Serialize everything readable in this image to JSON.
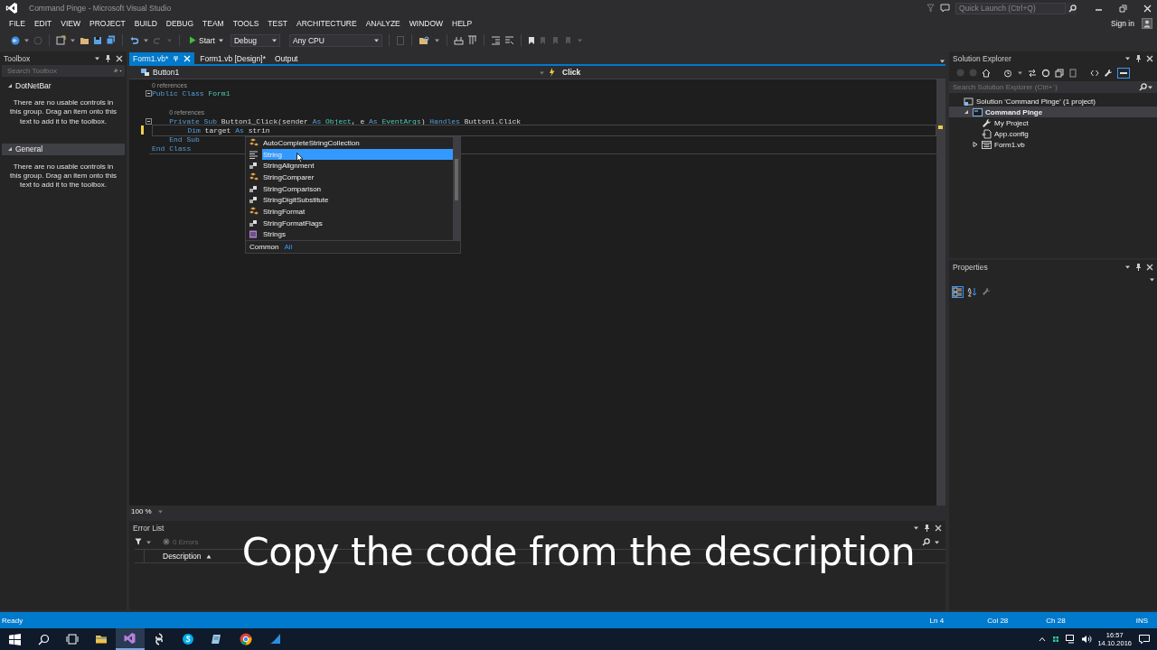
{
  "window": {
    "title": "Command Pinge - Microsoft Visual Studio"
  },
  "quick_launch": {
    "placeholder": "Quick Launch (Ctrl+Q)"
  },
  "account": "Sign in",
  "menu": [
    "FILE",
    "EDIT",
    "VIEW",
    "PROJECT",
    "BUILD",
    "DEBUG",
    "TEAM",
    "TOOLS",
    "TEST",
    "ARCHITECTURE",
    "ANALYZE",
    "WINDOW",
    "HELP"
  ],
  "toolbar": {
    "start": "Start",
    "configuration": "Debug",
    "platform": "Any CPU"
  },
  "toolbox": {
    "title": "Toolbox",
    "search_placeholder": "Search Toolbox",
    "groups": [
      {
        "name": "DotNetBar",
        "expanded": true,
        "selected": false,
        "message": "There are no usable controls in this group. Drag an item onto this text to add it to the toolbox."
      },
      {
        "name": "General",
        "expanded": true,
        "selected": true,
        "message": "There are no usable controls in this group. Drag an item onto this text to add it to the toolbox."
      }
    ]
  },
  "editor": {
    "tabs": [
      {
        "label": "Form1.vb*",
        "selected": true
      },
      {
        "label": "Form1.vb [Design]*",
        "selected": false
      },
      {
        "label": "Output",
        "selected": false
      }
    ],
    "member_bar": {
      "object": "Button1",
      "event": "Click"
    },
    "lines": [
      {
        "kind": "code",
        "lens": "0 references",
        "fold": true,
        "current": false,
        "modified": false,
        "tokens": [
          {
            "kind": "keyword",
            "t": "Public Class "
          },
          {
            "kind": "type",
            "t": "Form1"
          }
        ]
      },
      {
        "kind": "blank"
      },
      {
        "kind": "code",
        "lens": "0 references",
        "fold": true,
        "current": false,
        "modified": false,
        "tokens": [
          {
            "kind": "keyword",
            "t": "    Private Sub "
          },
          {
            "kind": "plain",
            "t": "Button1_Click(sender "
          },
          {
            "kind": "keyword",
            "t": "As "
          },
          {
            "kind": "type",
            "t": "Object"
          },
          {
            "kind": "plain",
            "t": ", e "
          },
          {
            "kind": "keyword",
            "t": "As "
          },
          {
            "kind": "type",
            "t": "EventArgs"
          },
          {
            "kind": "plain",
            "t": ") "
          },
          {
            "kind": "keyword",
            "t": "Handles "
          },
          {
            "kind": "plain",
            "t": "Button1.Click"
          }
        ]
      },
      {
        "kind": "code",
        "fold": false,
        "current": true,
        "modified": true,
        "tokens": [
          {
            "kind": "keyword",
            "t": "        Dim "
          },
          {
            "kind": "plain",
            "t": "target "
          },
          {
            "kind": "keyword",
            "t": "As "
          },
          {
            "kind": "plain",
            "t": "strin"
          }
        ]
      },
      {
        "kind": "code",
        "fold": false,
        "current": false,
        "modified": false,
        "tokens": [
          {
            "kind": "keyword",
            "t": "    End Sub"
          }
        ]
      },
      {
        "kind": "code",
        "fold": false,
        "current": false,
        "modified": false,
        "tokens": [
          {
            "kind": "keyword",
            "t": "End Class"
          }
        ]
      }
    ],
    "completion": {
      "items": [
        {
          "label": "AutoCompleteStringCollection",
          "kind": "class",
          "selected": false
        },
        {
          "label": "String",
          "kind": "builtin",
          "selected": true
        },
        {
          "label": "StringAlignment",
          "kind": "enum",
          "selected": false
        },
        {
          "label": "StringComparer",
          "kind": "class",
          "selected": false
        },
        {
          "label": "StringComparison",
          "kind": "enum",
          "selected": false
        },
        {
          "label": "StringDigitSubstitute",
          "kind": "enum",
          "selected": false
        },
        {
          "label": "StringFormat",
          "kind": "class",
          "selected": false
        },
        {
          "label": "StringFormatFlags",
          "kind": "enum",
          "selected": false
        },
        {
          "label": "Strings",
          "kind": "module",
          "selected": false
        }
      ],
      "filters": [
        {
          "label": "Common",
          "selected": false
        },
        {
          "label": "All",
          "selected": true
        }
      ]
    },
    "zoom": "100 %"
  },
  "solution_explorer": {
    "title": "Solution Explorer",
    "search_placeholder": "Search Solution Explorer (Ctrl+`)",
    "tree": [
      {
        "label": "Solution 'Command Pinge' (1 project)",
        "kind": "solution",
        "selected": false,
        "children": [
          {
            "label": "Command Pinge",
            "kind": "project",
            "expanded": true,
            "selected": true,
            "children": [
              {
                "label": "My Project",
                "kind": "settings",
                "selected": false
              },
              {
                "label": "App.config",
                "kind": "config",
                "selected": false
              },
              {
                "label": "Form1.vb",
                "kind": "form",
                "expanded": false,
                "selected": false
              }
            ]
          }
        ]
      }
    ]
  },
  "properties": {
    "title": "Properties"
  },
  "error_list": {
    "title": "Error List",
    "filters": [
      "0 Errors"
    ],
    "columns": [
      "Description"
    ]
  },
  "caption": "Copy the code from the description",
  "status_bar": {
    "message": "Ready",
    "line": "Ln 4",
    "column": "Col 28",
    "character": "Ch 28",
    "mode": "INS"
  },
  "taskbar": {
    "apps": [
      {
        "kind": "explorer",
        "selected": false
      },
      {
        "kind": "visual-studio",
        "selected": true
      },
      {
        "kind": "swirl",
        "selected": false
      },
      {
        "kind": "skype",
        "selected": false
      },
      {
        "kind": "notes",
        "selected": false
      },
      {
        "kind": "chrome",
        "selected": false
      },
      {
        "kind": "wave",
        "selected": false
      }
    ],
    "time": "16:57",
    "date": "14.10.2016"
  }
}
